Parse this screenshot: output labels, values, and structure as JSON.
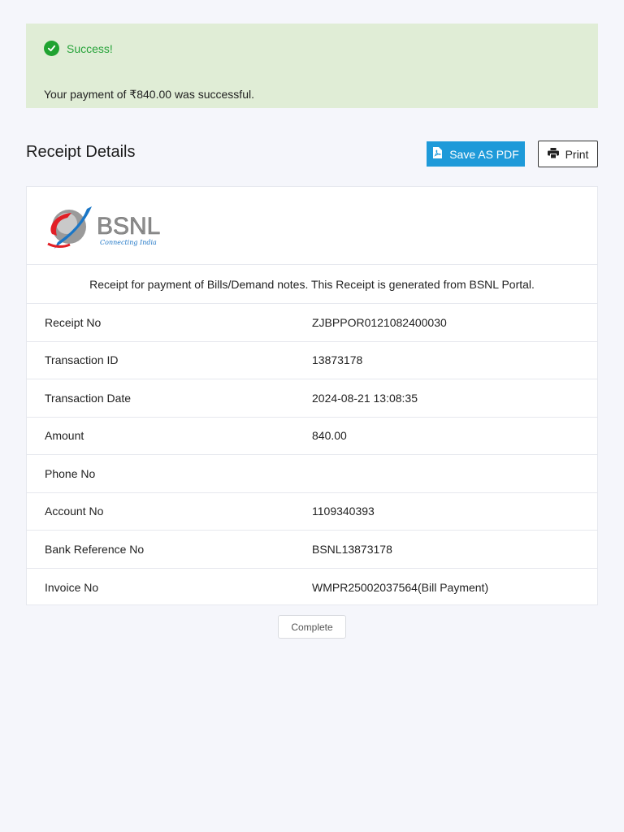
{
  "alert": {
    "title": "Success!",
    "message": "Your payment of ₹840.00 was successful.",
    "color": "#27a33a",
    "background": "#e0edd6"
  },
  "receipt": {
    "heading": "Receipt Details",
    "save_pdf_label": "Save AS PDF",
    "print_label": "Print",
    "caption": "Receipt for payment of Bills/Demand notes. This Receipt is generated from BSNL Portal.",
    "logo": {
      "text": "BSNL",
      "tagline": "Connecting India"
    },
    "rows": [
      {
        "label": "Receipt No",
        "value": "ZJBPPOR0121082400030"
      },
      {
        "label": "Transaction ID",
        "value": "13873178"
      },
      {
        "label": "Transaction Date",
        "value": "2024-08-21 13:08:35"
      },
      {
        "label": "Amount",
        "value": "840.00"
      },
      {
        "label": "Phone No",
        "value": ""
      },
      {
        "label": "Account No",
        "value": "1109340393"
      },
      {
        "label": "Bank Reference No",
        "value": "BSNL13873178"
      },
      {
        "label": "Invoice No",
        "value": "WMPR25002037564(Bill Payment)"
      }
    ]
  },
  "complete_label": "Complete",
  "colors": {
    "primary_button": "#1e9ad9",
    "page_background": "#f5f6fb"
  },
  "icons": {
    "success": "check-circle-icon",
    "pdf": "pdf-file-icon",
    "print": "printer-icon"
  }
}
